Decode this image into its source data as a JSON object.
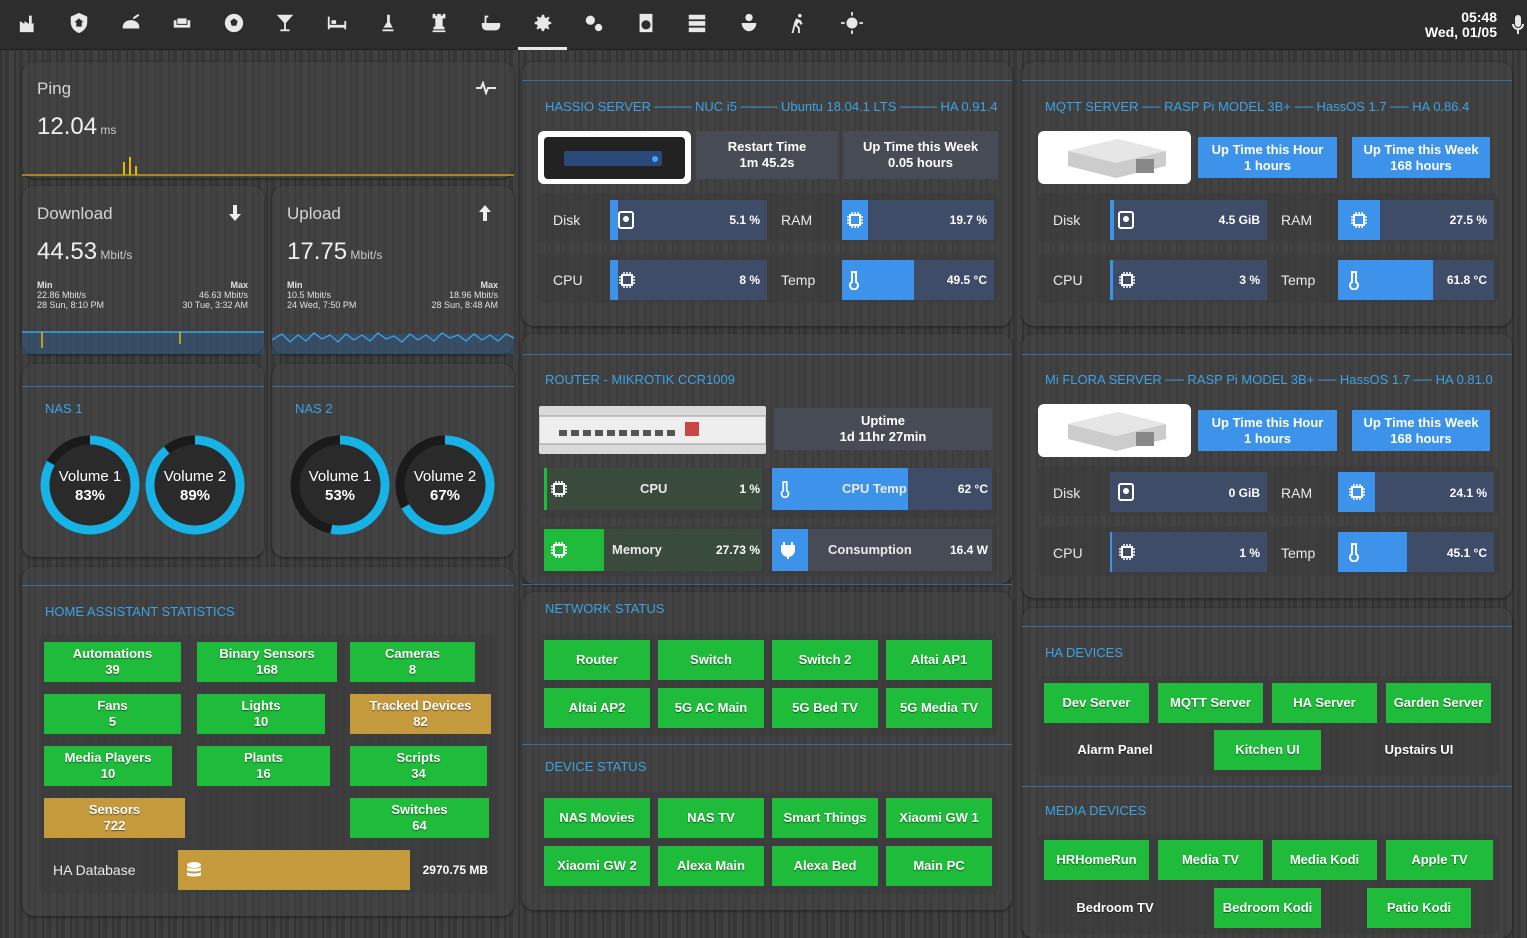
{
  "topbar": {
    "icons": [
      "factory-icon",
      "shield-home-icon",
      "robot-vacuum-icon",
      "sofa-icon",
      "soccer-icon",
      "cocktail-icon",
      "bed-icon",
      "person-icon",
      "chess-rook-icon",
      "bathtub-icon",
      "cog-icon",
      "cogs-icon",
      "washing-machine-icon",
      "server-icon",
      "flower-icon",
      "run-icon",
      "sun-icon"
    ],
    "time": "05:48",
    "date": "Wed, 01/05"
  },
  "ping": {
    "title": "Ping",
    "value": "12.04",
    "unit": "ms"
  },
  "download": {
    "title": "Download",
    "value": "44.53",
    "unit": "Mbit/s",
    "min_label": "Min",
    "min_val": "22.86 Mbit/s",
    "min_time": "28 Sun, 8:10 PM",
    "max_label": "Max",
    "max_val": "46.63 Mbit/s",
    "max_time": "30 Tue, 3:32 AM"
  },
  "upload": {
    "title": "Upload",
    "value": "17.75",
    "unit": "Mbit/s",
    "min_label": "Min",
    "min_val": "10.5 Mbit/s",
    "min_time": "24 Wed, 7:50 PM",
    "max_label": "Max",
    "max_val": "18.96 Mbit/s",
    "max_time": "28 Sun, 8:48 AM"
  },
  "nas1": {
    "title": "NAS 1",
    "volumes": [
      {
        "name": "Volume 1",
        "pct": 83,
        "label": "83%"
      },
      {
        "name": "Volume 2",
        "pct": 89,
        "label": "89%"
      }
    ]
  },
  "nas2": {
    "title": "NAS 2",
    "volumes": [
      {
        "name": "Volume 1",
        "pct": 53,
        "label": "53%"
      },
      {
        "name": "Volume 2",
        "pct": 67,
        "label": "67%"
      }
    ]
  },
  "ha_stats": {
    "title": "HOME ASSISTANT STATISTICS",
    "items": [
      {
        "name": "Automations",
        "value": "39"
      },
      {
        "name": "Binary Sensors",
        "value": "168"
      },
      {
        "name": "Cameras",
        "value": "8"
      },
      {
        "name": "Fans",
        "value": "5"
      },
      {
        "name": "Lights",
        "value": "10"
      },
      {
        "name": "Tracked Devices",
        "value": "82"
      },
      {
        "name": "Media Players",
        "value": "10"
      },
      {
        "name": "Plants",
        "value": "16"
      },
      {
        "name": "Scripts",
        "value": "34"
      },
      {
        "name": "Sensors",
        "value": "722"
      },
      {
        "name": "Switches",
        "value": "64"
      }
    ],
    "db_label": "HA Database",
    "db_value": "2970.75 MB"
  },
  "hassio": {
    "title": "HASSIO SERVER ──── NUC i5 ──── Ubuntu 18.04.1 LTS ──── HA 0.91.4",
    "restart_label": "Restart Time",
    "restart_value": "1m 45.2s",
    "week_label": "Up Time this Week",
    "week_value": "0.05 hours",
    "disk_label": "Disk",
    "disk_value": "5.1 %",
    "disk_pct": 5.1,
    "ram_label": "RAM",
    "ram_value": "19.7 %",
    "ram_pct": 19.7,
    "cpu_label": "CPU",
    "cpu_value": "8 %",
    "cpu_pct": 8,
    "temp_label": "Temp",
    "temp_value": "49.5 °C",
    "temp_pct": 49.5
  },
  "mqtt": {
    "title": "MQTT SERVER ── RASP Pi MODEL 3B+ ── HassOS 1.7 ── HA 0.86.4",
    "hour_label": "Up Time this Hour",
    "hour_value": "1 hours",
    "week_label": "Up Time this Week",
    "week_value": "168 hours",
    "disk_label": "Disk",
    "disk_value": "4.5 GiB",
    "ram_label": "RAM",
    "ram_value": "27.5 %",
    "cpu_label": "CPU",
    "cpu_value": "3 %",
    "temp_label": "Temp",
    "temp_value": "61.8 °C"
  },
  "router": {
    "title": "ROUTER - MIKROTIK CCR1009",
    "uptime_label": "Uptime",
    "uptime_value": "1d 11hr 27min",
    "cpu_label": "CPU",
    "cpu_value": "1 %",
    "cputemp_label": "CPU Temp",
    "cputemp_value": "62 °C",
    "mem_label": "Memory",
    "mem_value": "27.73 %",
    "cons_label": "Consumption",
    "cons_value": "16.4 W"
  },
  "miflora": {
    "title": "Mi FLORA SERVER ── RASP Pi MODEL 3B+ ── HassOS 1.7 ── HA 0.81.0",
    "hour_label": "Up Time this Hour",
    "hour_value": "1 hours",
    "week_label": "Up Time this Week",
    "week_value": "168 hours",
    "disk_label": "Disk",
    "disk_value": "0 GiB",
    "ram_label": "RAM",
    "ram_value": "24.1 %",
    "cpu_label": "CPU",
    "cpu_value": "1 %",
    "temp_label": "Temp",
    "temp_value": "45.1 °C"
  },
  "network": {
    "title": "NETWORK STATUS",
    "items": [
      "Router",
      "Switch",
      "Switch 2",
      "Altai AP1",
      "Altai AP2",
      "5G AC Main",
      "5G Bed TV",
      "5G Media TV"
    ]
  },
  "device": {
    "title": "DEVICE STATUS",
    "items": [
      "NAS Movies",
      "NAS TV",
      "Smart Things",
      "Xiaomi GW 1",
      "Xiaomi GW 2",
      "Alexa Main",
      "Alexa Bed",
      "Main PC"
    ]
  },
  "ha_devices": {
    "title": "HA DEVICES",
    "items": [
      "Dev Server",
      "MQTT Server",
      "HA Server",
      "Garden Server",
      "Alarm Panel",
      "Kitchen UI",
      "Upstairs UI"
    ]
  },
  "media_devices": {
    "title": "MEDIA DEVICES",
    "items": [
      "HRHomeRun",
      "Media TV",
      "Media Kodi",
      "Apple TV",
      "Bedroom TV",
      "Bedroom Kodi",
      "Patio Kodi"
    ]
  }
}
